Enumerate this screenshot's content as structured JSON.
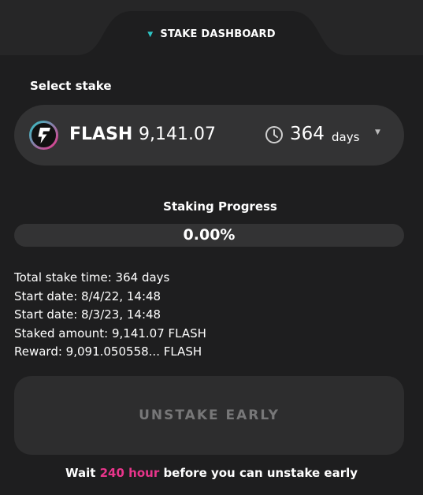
{
  "header": {
    "tab_label": "STAKE DASHBOARD"
  },
  "stake_selector": {
    "label": "Select stake",
    "token_name": "FLASH",
    "amount": "9,141.07",
    "days_value": "364",
    "days_unit": "days"
  },
  "progress": {
    "title": "Staking Progress",
    "value_text": "0.00%",
    "fraction": 0
  },
  "info": {
    "total_time": "Total stake time: 364 days",
    "start_date": "Start date: 8/4/22, 14:48",
    "second_date": "Start date: 8/3/23, 14:48",
    "staked_amount": "Staked amount: 9,141.07 FLASH",
    "reward": "Reward: 9,091.050558... FLASH"
  },
  "unstake": {
    "button_label": "UNSTAKE EARLY"
  },
  "wait": {
    "prefix": "Wait ",
    "highlight": "240 hour",
    "suffix": " before you can unstake early"
  },
  "colors": {
    "accent_cyan": "#2ec4c4",
    "accent_pink": "#e8358b",
    "background": "#1e1e1f"
  },
  "icons": {
    "tab_caret": "caret-down-icon",
    "token": "flash-token-logo",
    "duration": "clock-icon",
    "dropdown": "chevron-down-icon"
  }
}
